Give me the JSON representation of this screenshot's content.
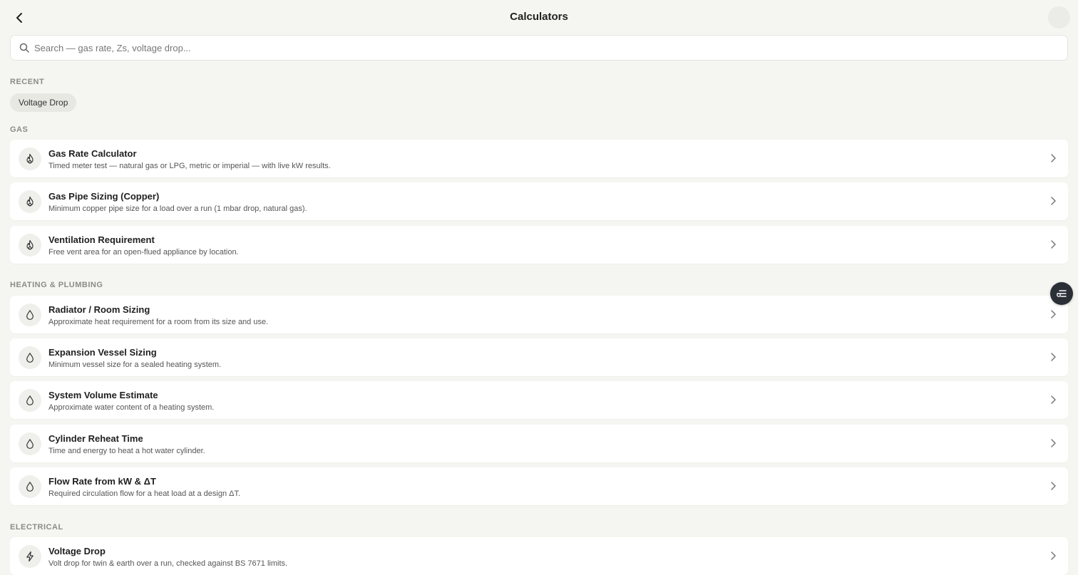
{
  "header": {
    "title": "Calculators",
    "back_icon": "chevron-left-icon",
    "avatar_icon": "avatar"
  },
  "search": {
    "placeholder": "Search — gas rate, Zs, voltage drop...",
    "value": "",
    "icon": "search-icon"
  },
  "recent": {
    "label": "RECENT",
    "items": [
      "Voltage Drop"
    ]
  },
  "sections": {
    "gas": {
      "label": "GAS",
      "icon": "flame-icon",
      "items": [
        {
          "title": "Gas Rate Calculator",
          "desc": "Timed meter test — natural gas or LPG, metric or imperial — with live kW results."
        },
        {
          "title": "Gas Pipe Sizing (Copper)",
          "desc": "Minimum copper pipe size for a load over a run (1 mbar drop, natural gas)."
        },
        {
          "title": "Ventilation Requirement",
          "desc": "Free vent area for an open-flued appliance by location."
        }
      ]
    },
    "heating": {
      "label": "HEATING & PLUMBING",
      "icon": "droplet-icon",
      "items": [
        {
          "title": "Radiator / Room Sizing",
          "desc": "Approximate heat requirement for a room from its size and use."
        },
        {
          "title": "Expansion Vessel Sizing",
          "desc": "Minimum vessel size for a sealed heating system."
        },
        {
          "title": "System Volume Estimate",
          "desc": "Approximate water content of a heating system."
        },
        {
          "title": "Cylinder Reheat Time",
          "desc": "Time and energy to heat a hot water cylinder."
        },
        {
          "title": "Flow Rate from kW & ΔT",
          "desc": "Required circulation flow for a heat load at a design ΔT."
        }
      ]
    },
    "electrical": {
      "label": "ELECTRICAL",
      "icon": "lightning-icon",
      "items": [
        {
          "title": "Voltage Drop",
          "desc": "Volt drop for twin & earth over a run, checked against BS 7671 limits."
        }
      ]
    }
  },
  "floating_button": {
    "icon": "toggle-settings-icon"
  },
  "colors": {
    "background": "#f5f5f1",
    "card": "#ffffff",
    "section_label": "#8c8c87",
    "fab": "#2b2f36"
  }
}
